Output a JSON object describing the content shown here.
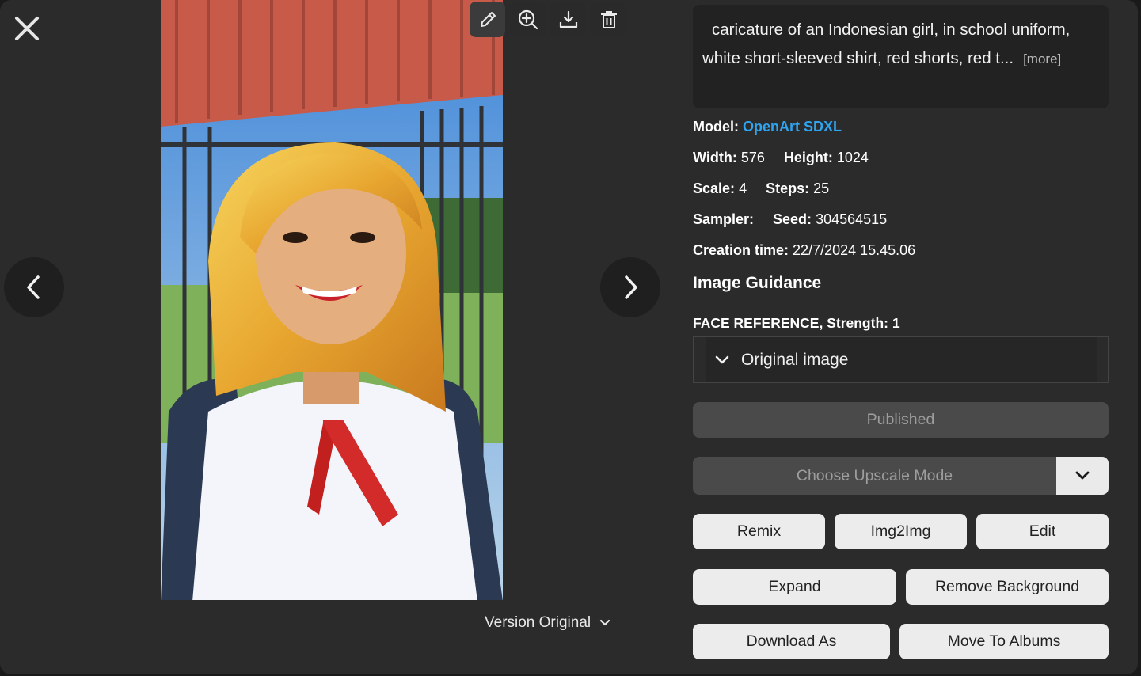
{
  "prompt": {
    "text": "caricature of an Indonesian girl, in school uniform, white short-sleeved shirt, red shorts, red t...",
    "more_label": "[more]"
  },
  "meta": {
    "model_label": "Model:",
    "model_value": "OpenArt SDXL",
    "width_label": "Width:",
    "width_value": "576",
    "height_label": "Height:",
    "height_value": "1024",
    "scale_label": "Scale:",
    "scale_value": "4",
    "steps_label": "Steps:",
    "steps_value": "25",
    "sampler_label": "Sampler:",
    "sampler_value": "",
    "seed_label": "Seed:",
    "seed_value": "304564515",
    "creation_label": "Creation time:",
    "creation_value": "22/7/2024 15.45.06"
  },
  "guidance": {
    "title": "Image Guidance",
    "face_reference": "FACE REFERENCE, Strength: 1",
    "dropdown_value": "Original image"
  },
  "actions": {
    "published": "Published",
    "upscale_placeholder": "Choose Upscale Mode",
    "remix": "Remix",
    "img2img": "Img2Img",
    "edit": "Edit",
    "expand": "Expand",
    "remove_background": "Remove Background",
    "download_as": "Download As",
    "move_to_albums": "Move To Albums"
  },
  "version_label": "Version Original",
  "icons": {
    "close": "close-icon",
    "prev": "chevron-left-icon",
    "next": "chevron-right-icon",
    "edit": "pencil-icon",
    "zoom": "zoom-in-icon",
    "download": "download-icon",
    "delete": "trash-icon"
  },
  "colors": {
    "accent_link": "#2fa4f0",
    "background": "#2b2b2b"
  }
}
